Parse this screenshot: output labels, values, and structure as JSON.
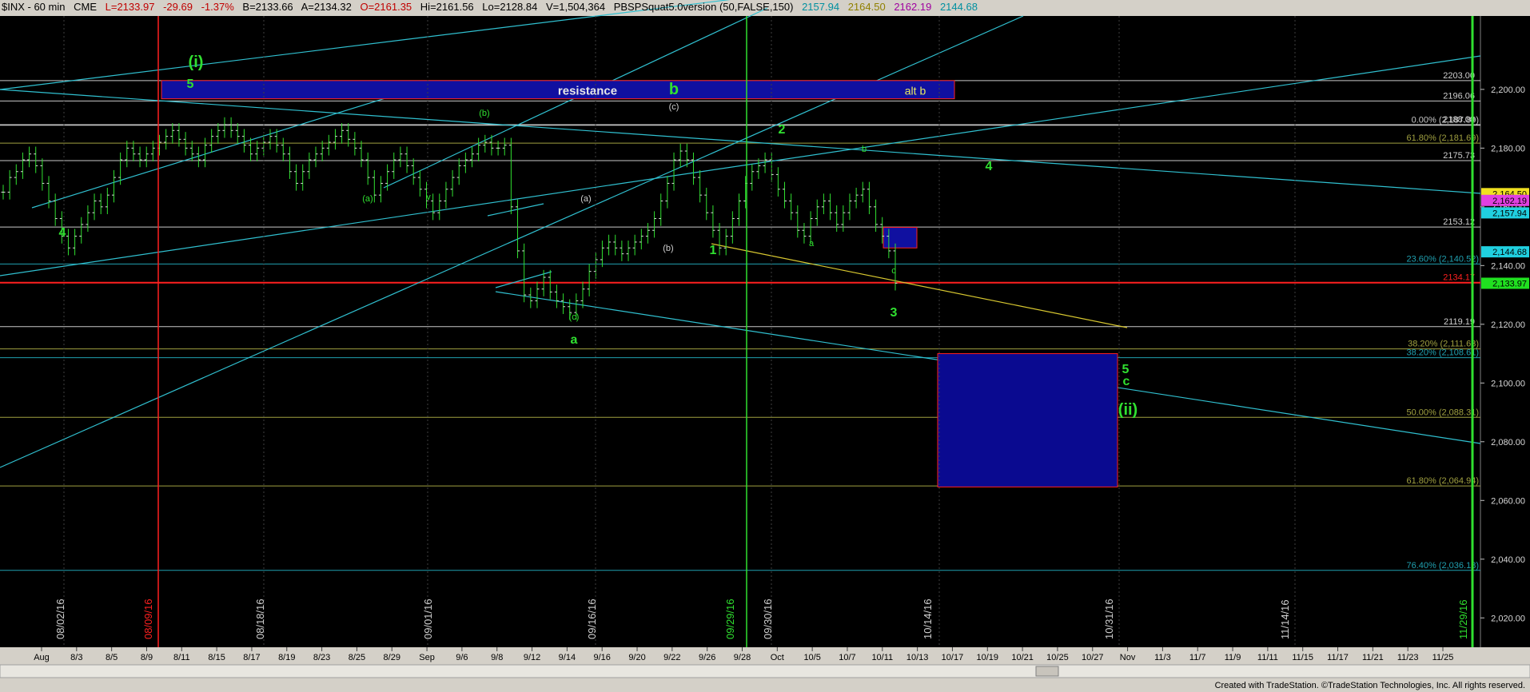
{
  "header": {
    "symbol": "$INX - 60 min",
    "exchange": "CME",
    "last": "L=2133.97",
    "change": "-29.69",
    "change_pct": "-1.37%",
    "bid": "B=2133.66",
    "ask": "A=2134.32",
    "open": "O=2161.35",
    "high": "Hi=2161.56",
    "low": "Lo=2128.84",
    "volume": "V=1,504,364",
    "study": "PBSPSquat5.0version (50,FALSE,150)",
    "study_values": [
      "2157.94",
      "2164.50",
      "2162.19",
      "2144.68"
    ],
    "study_colors": [
      "#20d0e0",
      "#f0e060",
      "#e040e0",
      "#20d0e0"
    ]
  },
  "footer": "Created with TradeStation. ©TradeStation Technologies, Inc. All rights reserved.",
  "chart_data": {
    "type": "candlestick",
    "title": "$INX - 60 min",
    "ylim": [
      2010,
      2225
    ],
    "y_ticks": [
      2020,
      2040,
      2060,
      2080,
      2100,
      2120,
      2140,
      2160,
      2180,
      2200
    ],
    "y_tick_labels": [
      "2,020.00",
      "2,040.00",
      "2,060.00",
      "2,080.00",
      "2,100.00",
      "2,120.00",
      "2,140.00",
      "2,160.00",
      "2,180.00",
      "2,200.00"
    ],
    "x_labels": [
      "Aug",
      "8/3",
      "8/5",
      "8/9",
      "8/11",
      "8/15",
      "8/17",
      "8/19",
      "8/23",
      "8/25",
      "8/29",
      "Sep",
      "9/6",
      "9/8",
      "9/12",
      "9/14",
      "9/16",
      "9/20",
      "9/22",
      "9/26",
      "9/28",
      "Oct",
      "10/5",
      "10/7",
      "10/11",
      "10/13",
      "10/17",
      "10/19",
      "10/21",
      "10/25",
      "10/27",
      "Nov",
      "11/3",
      "11/7",
      "11/9",
      "11/11",
      "11/15",
      "11/17",
      "11/21",
      "11/23",
      "11/25"
    ],
    "vertical_date_labels": [
      "08/02/16",
      "08/09/16",
      "08/18/16",
      "09/01/16",
      "09/16/16",
      "09/29/16",
      "09/30/16",
      "10/14/16",
      "10/31/16",
      "11/14/16",
      "11/29/16"
    ],
    "horizontal_levels": [
      {
        "value": 2203.0,
        "label": "2203.00",
        "color": "#c8c8c8"
      },
      {
        "value": 2196.06,
        "label": "2196.06",
        "color": "#c8c8c8"
      },
      {
        "value": 2188.0,
        "label": "2188.00",
        "color": "#c8c8c8"
      },
      {
        "value": 2175.73,
        "label": "2175.73",
        "color": "#c8c8c8"
      },
      {
        "value": 2153.12,
        "label": "2153.12",
        "color": "#c8c8c8"
      },
      {
        "value": 2119.19,
        "label": "2119.19",
        "color": "#c8c8c8"
      },
      {
        "value": 2134.17,
        "label": "2134.17",
        "color": "#ff2020"
      }
    ],
    "fib_levels": [
      {
        "value": 2187.8,
        "label": "0.00% (2,187.80)",
        "color": "#c8c8c8"
      },
      {
        "value": 2181.69,
        "label": "61.80% (2,181.69)",
        "color": "#a0a040"
      },
      {
        "value": 2140.52,
        "label": "23.60% (2,140.52)",
        "color": "#20a0b0"
      },
      {
        "value": 2111.63,
        "label": "38.20% (2,111.63)",
        "color": "#a0a040"
      },
      {
        "value": 2108.61,
        "label": "38.20% (2,108.61)",
        "color": "#20a0b0"
      },
      {
        "value": 2088.31,
        "label": "50.00% (2,088.31)",
        "color": "#a0a040"
      },
      {
        "value": 2064.94,
        "label": "61.80% (2,064.94)",
        "color": "#a0a040"
      },
      {
        "value": 2036.18,
        "label": "76.40% (2,036.18)",
        "color": "#20a0b0"
      }
    ],
    "price_tags": [
      {
        "value": 2164.5,
        "label": "2,164.50",
        "color": "#f0e020"
      },
      {
        "value": 2162.19,
        "label": "2,162.19",
        "color": "#e040e0"
      },
      {
        "value": 2157.94,
        "label": "2,157.94",
        "color": "#20d0e0"
      },
      {
        "value": 2144.68,
        "label": "2,144.68",
        "color": "#20d0e0"
      },
      {
        "value": 2133.97,
        "label": "2,133.97",
        "color": "#20e020"
      }
    ],
    "wave_labels": [
      {
        "text": "(i)",
        "size": "large"
      },
      {
        "text": "5",
        "size": "medium"
      },
      {
        "text": "4",
        "size": "medium"
      },
      {
        "text": "(a)",
        "size": "small"
      },
      {
        "text": "v",
        "size": "small"
      },
      {
        "text": "(b)",
        "size": "small"
      },
      {
        "text": "b",
        "size": "large"
      },
      {
        "text": "(c)",
        "size": "small"
      },
      {
        "text": "(a)",
        "size": "small"
      },
      {
        "text": "(b)",
        "size": "small"
      },
      {
        "text": "(c)",
        "size": "small"
      },
      {
        "text": "a",
        "size": "medium"
      },
      {
        "text": "1",
        "size": "medium"
      },
      {
        "text": "2",
        "size": "medium"
      },
      {
        "text": "a",
        "size": "small"
      },
      {
        "text": "b",
        "size": "small"
      },
      {
        "text": "c",
        "size": "small"
      },
      {
        "text": "3",
        "size": "medium"
      },
      {
        "text": "4",
        "size": "medium"
      },
      {
        "text": "5",
        "size": "medium"
      },
      {
        "text": "c",
        "size": "medium"
      },
      {
        "text": "(ii)",
        "size": "large"
      }
    ],
    "boxes": [
      {
        "label": "resistance",
        "sublabel": "alt b",
        "top": 2203.0,
        "bottom": 2196.8,
        "color": "#1010a0"
      },
      {
        "label": "",
        "top": 2153.0,
        "bottom": 2146.0,
        "color": "#1010a0"
      },
      {
        "label": "",
        "top": 2110.0,
        "bottom": 2064.6,
        "color": "#0a0a90"
      }
    ],
    "grid": false,
    "series": [
      {
        "name": "$INX",
        "values": [
          2165,
          2170,
          2172,
          2176,
          2178,
          2174,
          2168,
          2162,
          2156,
          2150,
          2146,
          2150,
          2154,
          2158,
          2162,
          2160,
          2164,
          2170,
          2176,
          2180,
          2178,
          2176,
          2178,
          2180,
          2182,
          2184,
          2186,
          2183,
          2180,
          2178,
          2176,
          2181,
          2184,
          2186,
          2188,
          2186,
          2184,
          2181,
          2178,
          2180,
          2182,
          2184,
          2181,
          2178,
          2172,
          2168,
          2172,
          2176,
          2178,
          2180,
          2182,
          2184,
          2186,
          2183,
          2180,
          2176,
          2170,
          2164,
          2168,
          2172,
          2176,
          2178,
          2174,
          2170,
          2166,
          2162,
          2158,
          2162,
          2166,
          2170,
          2174,
          2176,
          2178,
          2181,
          2182,
          2180,
          2180,
          2181,
          2160,
          2145,
          2130,
          2128,
          2132,
          2136,
          2131,
          2128,
          2126,
          2124,
          2128,
          2132,
          2138,
          2142,
          2146,
          2148,
          2146,
          2144,
          2146,
          2148,
          2150,
          2152,
          2156,
          2162,
          2168,
          2176,
          2179,
          2176,
          2170,
          2164,
          2158,
          2152,
          2146,
          2150,
          2156,
          2162,
          2168,
          2172,
          2174,
          2176,
          2171,
          2166,
          2162,
          2158,
          2152,
          2150,
          2156,
          2160,
          2162,
          2158,
          2154,
          2158,
          2162,
          2164,
          2166,
          2160,
          2154,
          2150,
          2145,
          2134
        ]
      }
    ]
  }
}
